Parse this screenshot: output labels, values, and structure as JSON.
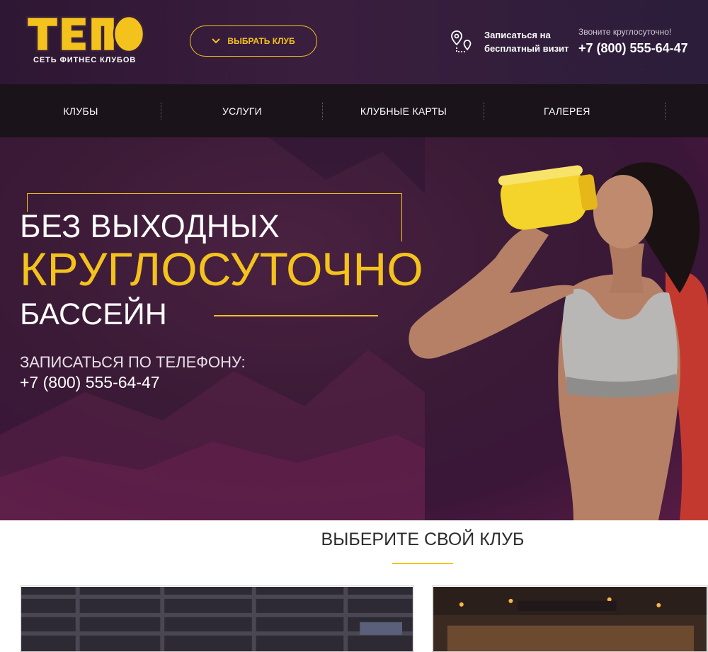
{
  "brand": {
    "logo_text": "ТЕЛО",
    "tagline": "СЕТЬ ФИТНЕС КЛУБОВ",
    "accent_color": "#f4c21d"
  },
  "header": {
    "club_button_label": "ВЫБРАТЬ КЛУБ",
    "visit_label": "Записаться на бесплатный визит",
    "phone_caption": "Звоните круглосуточно!",
    "phone_number": "+7 (800) 555-64-47"
  },
  "nav": {
    "items": [
      {
        "label": "КЛУБЫ"
      },
      {
        "label": "УСЛУГИ"
      },
      {
        "label": "КЛУБНЫЕ КАРТЫ"
      },
      {
        "label": "ГАЛЕРЕЯ"
      }
    ]
  },
  "hero": {
    "line1": "БЕЗ ВЫХОДНЫХ",
    "line2": "КРУГЛОСУТОЧНО",
    "line3": "БАССЕЙН",
    "call_label": "ЗАПИСАТЬСЯ ПО ТЕЛЕФОНУ:",
    "phone": "+7 (800) 555-64-47"
  },
  "clubs_section": {
    "title": "ВЫБЕРИТЕ СВОЙ КЛУБ"
  },
  "icons": [
    "chevron-down-icon",
    "map-route-icon"
  ]
}
